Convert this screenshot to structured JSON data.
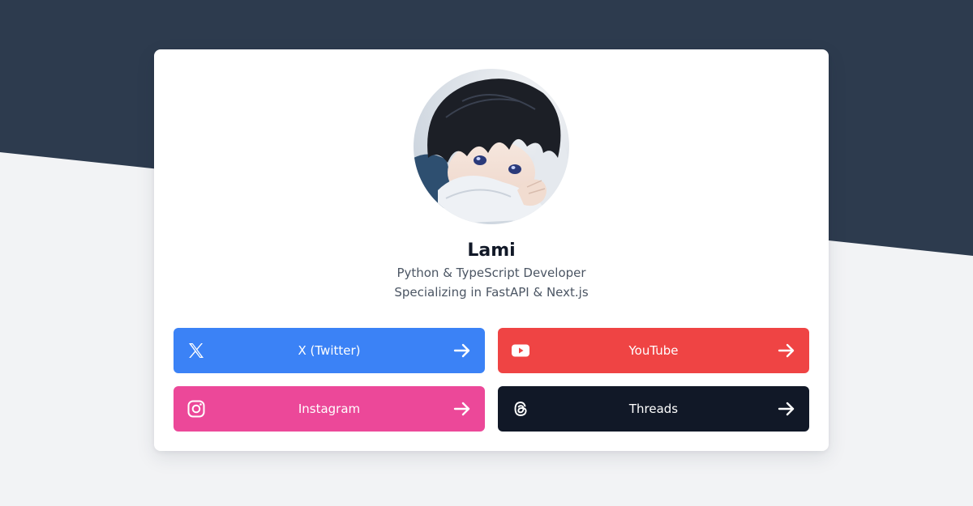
{
  "profile": {
    "name": "Lami",
    "bio_line1": "Python & TypeScript Developer",
    "bio_line2": "Specializing in FastAPI & Next.js"
  },
  "links": [
    {
      "label": "X (Twitter)",
      "icon": "x-logo-icon",
      "color": "#3b82f6"
    },
    {
      "label": "YouTube",
      "icon": "youtube-icon",
      "color": "#ef4444"
    },
    {
      "label": "Instagram",
      "icon": "instagram-icon",
      "color": "#ec4899"
    },
    {
      "label": "Threads",
      "icon": "threads-icon",
      "color": "#111827"
    }
  ],
  "colors": {
    "header_dark": "#2d3b4e",
    "page_background": "#f2f3f5",
    "card_background": "#ffffff"
  }
}
